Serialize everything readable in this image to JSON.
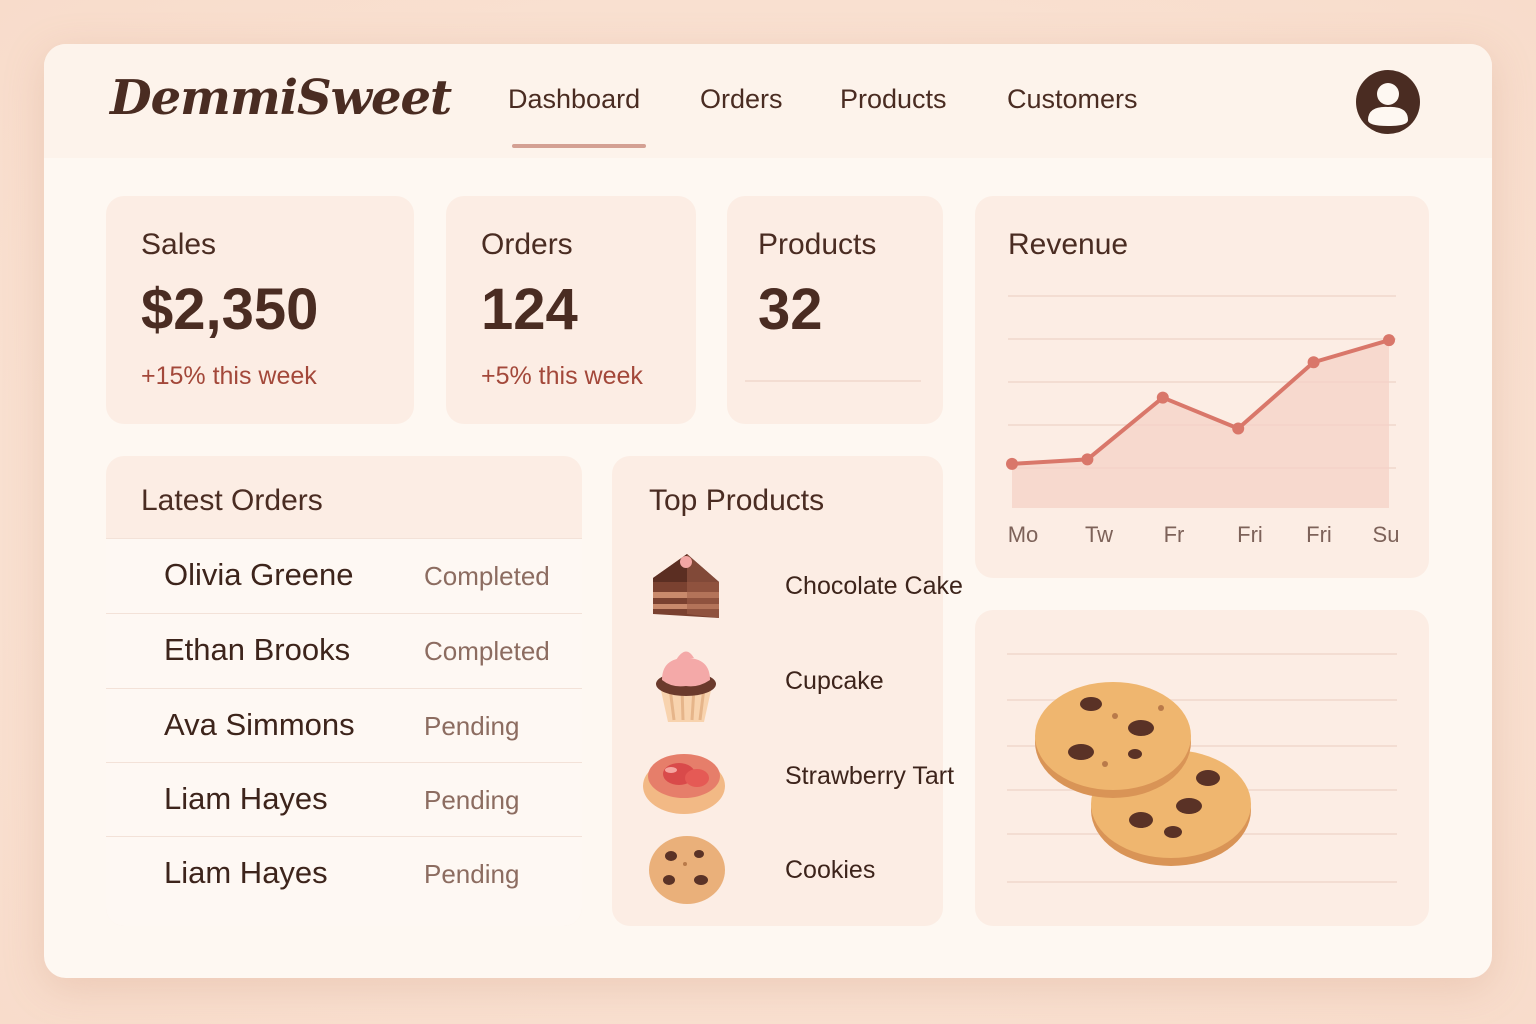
{
  "app": {
    "name": "DemmiSweet"
  },
  "nav": {
    "items": [
      {
        "label": "Dashboard",
        "active": true
      },
      {
        "label": "Orders"
      },
      {
        "label": "Products"
      },
      {
        "label": "Customers"
      }
    ]
  },
  "stats": [
    {
      "label": "Sales",
      "value": "$2,350",
      "change": "+15% this week"
    },
    {
      "label": "Orders",
      "value": "124",
      "change": "+5% this week"
    },
    {
      "label": "Products",
      "value": "32",
      "change": ""
    }
  ],
  "revenue": {
    "title": "Revenue",
    "chart_data": {
      "type": "area",
      "title": "Revenue",
      "categories": [
        "Mo",
        "Tw",
        "Fr",
        "Fri",
        "Fri",
        "Su"
      ],
      "x": [
        0,
        1,
        2,
        3,
        4,
        5
      ],
      "values": [
        1,
        1.1,
        2.5,
        1.8,
        3.3,
        3.8
      ],
      "ylim": [
        0,
        4.8
      ],
      "grid": true,
      "colors": {
        "line": "#d9776a",
        "fill": "#f6d2c7"
      }
    }
  },
  "latest_orders": {
    "title": "Latest Orders",
    "rows": [
      {
        "name": "Olivia Greene",
        "status": "Completed"
      },
      {
        "name": "Ethan Brooks",
        "status": "Completed"
      },
      {
        "name": "Ava Simmons",
        "status": "Pending"
      },
      {
        "name": "Liam Hayes",
        "status": "Pending"
      },
      {
        "name": "Liam Hayes",
        "status": "Pending"
      }
    ]
  },
  "top_products": {
    "title": "Top Products",
    "items": [
      {
        "name": "Chocolate Cake",
        "icon": "chocolate-cake-icon"
      },
      {
        "name": "Cupcake",
        "icon": "cupcake-icon"
      },
      {
        "name": "Strawberry Tart",
        "icon": "strawberry-tart-icon"
      },
      {
        "name": "Cookies",
        "icon": "cookie-icon"
      }
    ]
  },
  "colors": {
    "accent": "#d4a093",
    "positive_change": "#a3483a",
    "text": "#4a2c22",
    "card": "#fcede4"
  }
}
